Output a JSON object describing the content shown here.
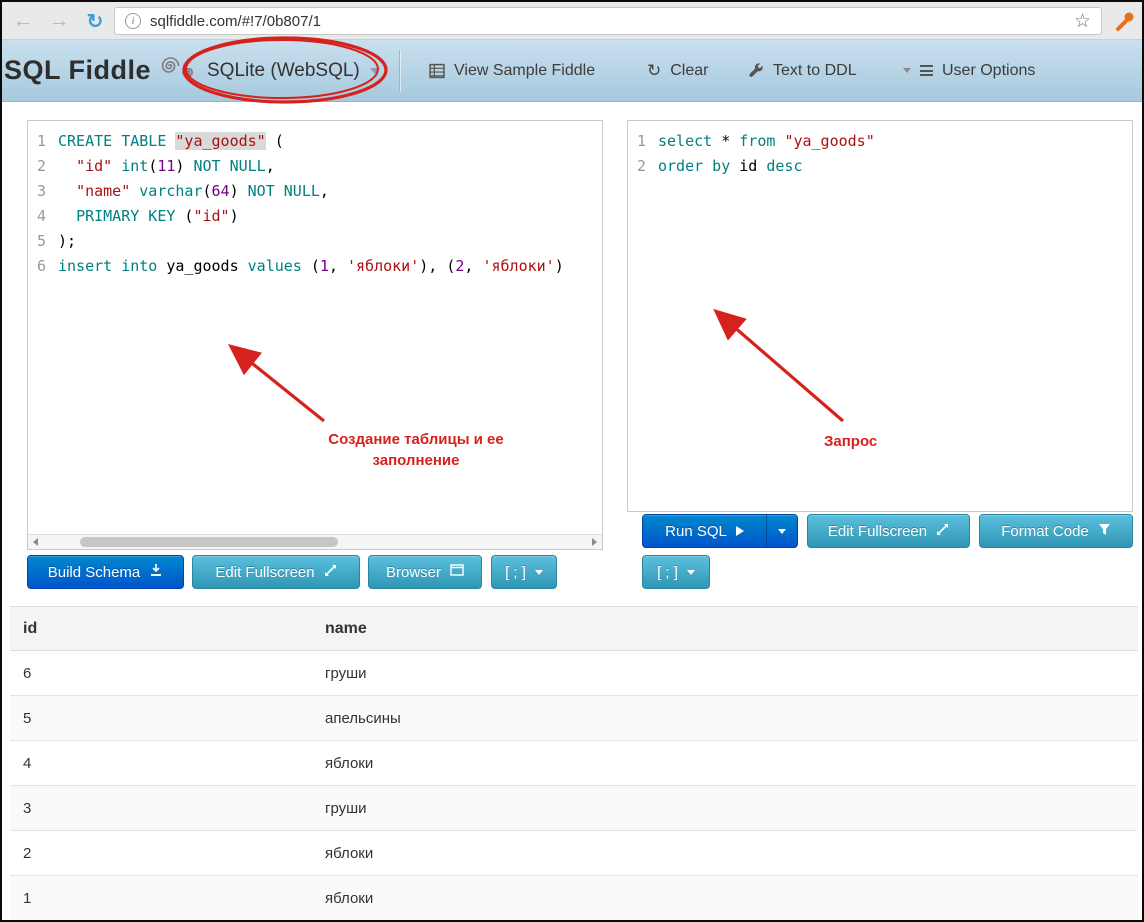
{
  "colors": {
    "annotation_red": "#d6221c",
    "header_gradient_top": "#c9e0ee",
    "header_gradient_bottom": "#a6c9de",
    "btn_primary_top": "#0088cc",
    "btn_primary_bottom": "#0055cc",
    "btn_info_top": "#5bc0de",
    "btn_info_bottom": "#2f96b4",
    "code_keyword": "#008080",
    "code_string": "#aa1111",
    "code_number": "#770088",
    "refresh_blue": "#3f9fd8"
  },
  "browser": {
    "url": "sqlfiddle.com/#!7/0b807/1"
  },
  "icons": {
    "back": "←",
    "forward": "→",
    "refresh": "↻",
    "star": "☆",
    "info": "i",
    "clear": "↻"
  },
  "header": {
    "logo_text": "SQL Fiddle",
    "db_selector_label": "SQLite (WebSQL)",
    "menu": {
      "view_sample": "View Sample Fiddle",
      "clear": "Clear",
      "text_to_ddl": "Text to DDL",
      "user_options": "User Options"
    }
  },
  "schema_editor": {
    "lines": [
      [
        [
          "kw",
          "CREATE TABLE"
        ],
        [
          "txt",
          " "
        ],
        [
          "strhl",
          "\"ya_goods\""
        ],
        [
          "txt",
          " ("
        ]
      ],
      [
        [
          "txt",
          "  "
        ],
        [
          "str",
          "\"id\""
        ],
        [
          "txt",
          " "
        ],
        [
          "kw",
          "int"
        ],
        [
          "txt",
          "("
        ],
        [
          "num",
          "11"
        ],
        [
          "txt",
          ") "
        ],
        [
          "kw",
          "NOT NULL"
        ],
        [
          "txt",
          ","
        ]
      ],
      [
        [
          "txt",
          "  "
        ],
        [
          "str",
          "\"name\""
        ],
        [
          "txt",
          " "
        ],
        [
          "kw",
          "varchar"
        ],
        [
          "txt",
          "("
        ],
        [
          "num",
          "64"
        ],
        [
          "txt",
          ") "
        ],
        [
          "kw",
          "NOT NULL"
        ],
        [
          "txt",
          ","
        ]
      ],
      [
        [
          "txt",
          "  "
        ],
        [
          "kw",
          "PRIMARY KEY"
        ],
        [
          "txt",
          " ("
        ],
        [
          "str",
          "\"id\""
        ],
        [
          "txt",
          ")"
        ]
      ],
      [
        [
          "txt",
          ");"
        ]
      ],
      [
        [
          "kw",
          "insert into"
        ],
        [
          "txt",
          " ya_goods "
        ],
        [
          "kw",
          "values"
        ],
        [
          "txt",
          " ("
        ],
        [
          "num",
          "1"
        ],
        [
          "txt",
          ", "
        ],
        [
          "str",
          "'яблоки'"
        ],
        [
          "txt",
          "), ("
        ],
        [
          "num",
          "2"
        ],
        [
          "txt",
          ", "
        ],
        [
          "str",
          "'яблоки'"
        ],
        [
          "txt",
          ")"
        ]
      ]
    ]
  },
  "query_editor": {
    "lines": [
      [
        [
          "kw",
          "select"
        ],
        [
          "txt",
          " * "
        ],
        [
          "kw",
          "from"
        ],
        [
          "txt",
          " "
        ],
        [
          "str",
          "\"ya_goods\""
        ]
      ],
      [
        [
          "kw",
          "order by"
        ],
        [
          "txt",
          " id "
        ],
        [
          "kw",
          "desc"
        ]
      ]
    ]
  },
  "schema_actions": {
    "build": "Build Schema",
    "fullscreen": "Edit Fullscreen",
    "browser": "Browser",
    "terminator": "[ ; ]"
  },
  "query_actions": {
    "run": "Run SQL",
    "fullscreen": "Edit Fullscreen",
    "format": "Format Code",
    "terminator": "[ ; ]"
  },
  "results": {
    "columns": [
      "id",
      "name"
    ],
    "rows": [
      [
        "6",
        "груши"
      ],
      [
        "5",
        "апельсины"
      ],
      [
        "4",
        "яблоки"
      ],
      [
        "3",
        "груши"
      ],
      [
        "2",
        "яблоки"
      ],
      [
        "1",
        "яблоки"
      ]
    ]
  },
  "annotations": {
    "schema_note": "Создание таблицы и ее заполнение",
    "query_note": "Запрос"
  }
}
